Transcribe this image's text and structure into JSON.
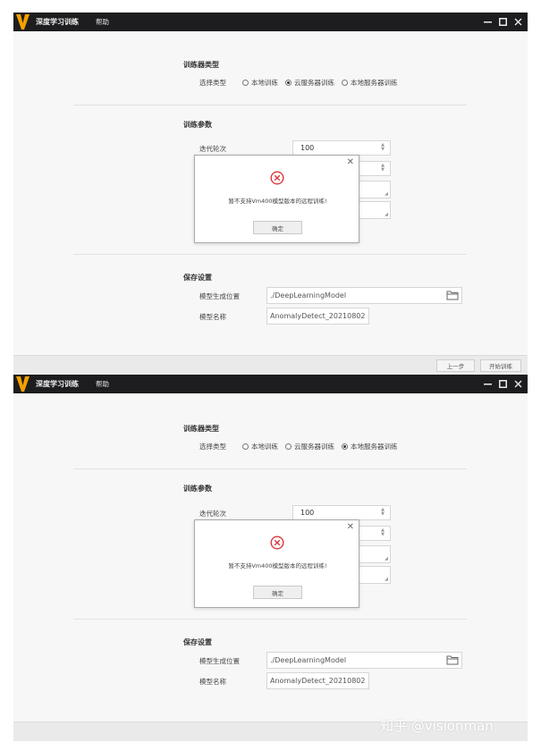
{
  "colors": {
    "titlebar": "#1d1d1f",
    "logo": "#f5a000",
    "error": "#d9383a"
  },
  "titlebar": {
    "app_title": "深度学习训练",
    "help_menu": "帮助",
    "min_icon": "minimize-icon",
    "max_icon": "maximize-icon",
    "close_icon": "close-icon"
  },
  "trainer": {
    "section_title": "训练器类型",
    "select_label": "选择类型",
    "options": [
      "本地训练",
      "云服务器训练",
      "本地服务器训练"
    ]
  },
  "params": {
    "section_title": "训练参数",
    "iterations_label": "迭代轮次",
    "iterations_value": "100"
  },
  "save": {
    "section_title": "保存设置",
    "path_label": "模型生成位置",
    "path_value": "./DeepLearningModel",
    "name_label": "模型名称",
    "name_value": "AnomalyDetect_20210802"
  },
  "footer": {
    "prev": "上一步",
    "start": "开始训练"
  },
  "dialog": {
    "message": "暂不支持Vm400模型版本的远程训练!",
    "ok": "确定",
    "close_icon": "close-icon",
    "error_icon": "error-circle-icon"
  },
  "screens": [
    {
      "selected_option": 1
    },
    {
      "selected_option": 2
    }
  ],
  "watermark": "知乎 @visionman"
}
